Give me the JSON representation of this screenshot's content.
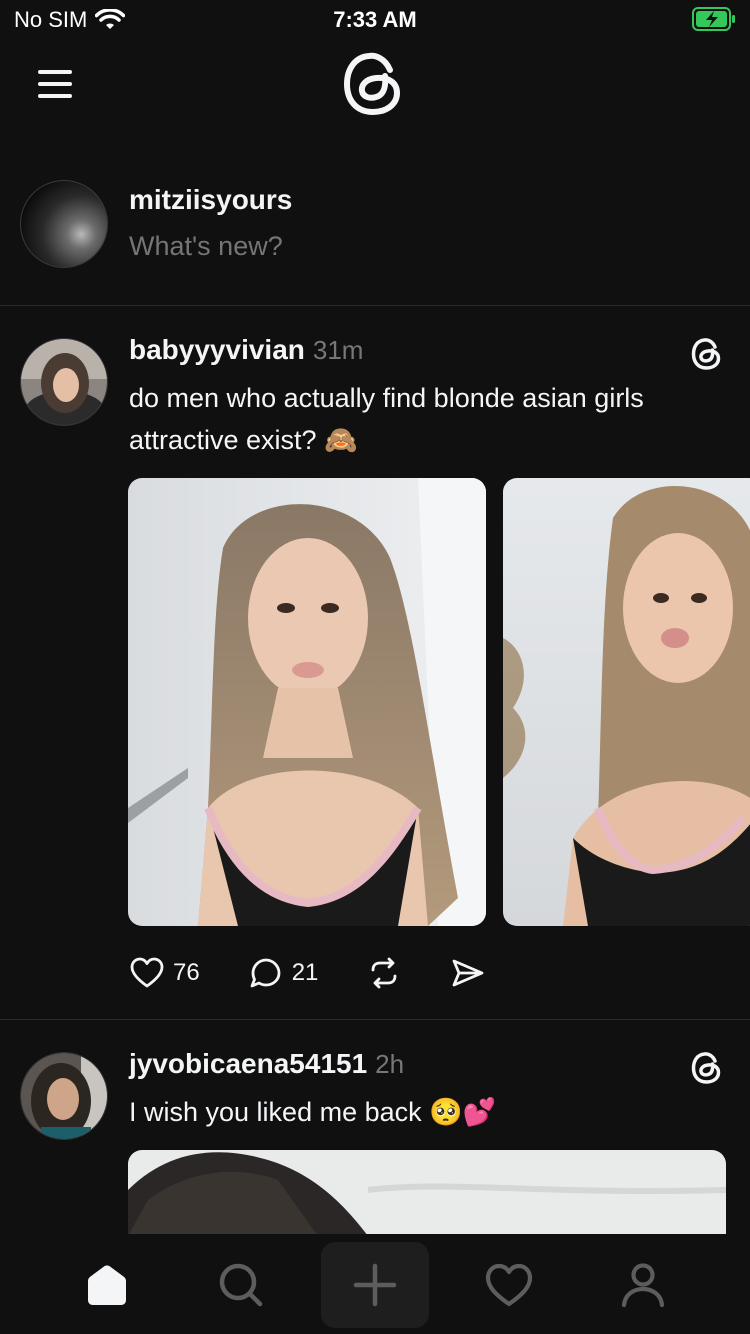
{
  "status_bar": {
    "carrier": "No SIM",
    "time": "7:33 AM",
    "battery_color": "#34c759"
  },
  "composer": {
    "username": "mitziisyours",
    "placeholder": "What's new?"
  },
  "posts": [
    {
      "username": "babyyyvivian",
      "time": "31m",
      "text": "do men who actually find blonde asian girls attractive exist? 🙈",
      "likes": "76",
      "replies": "21"
    },
    {
      "username": "jyvobicaena54151",
      "time": "2h",
      "text": "I wish you liked me back 🥺💕"
    }
  ],
  "colors": {
    "background": "#101010",
    "text": "#f3f5f7",
    "secondary_text": "#777777",
    "divider": "#2c2c2c"
  },
  "tab_bar": {
    "items": [
      "home-icon",
      "search-icon",
      "create-icon",
      "activity-icon",
      "profile-icon"
    ],
    "selected": "home-icon"
  }
}
